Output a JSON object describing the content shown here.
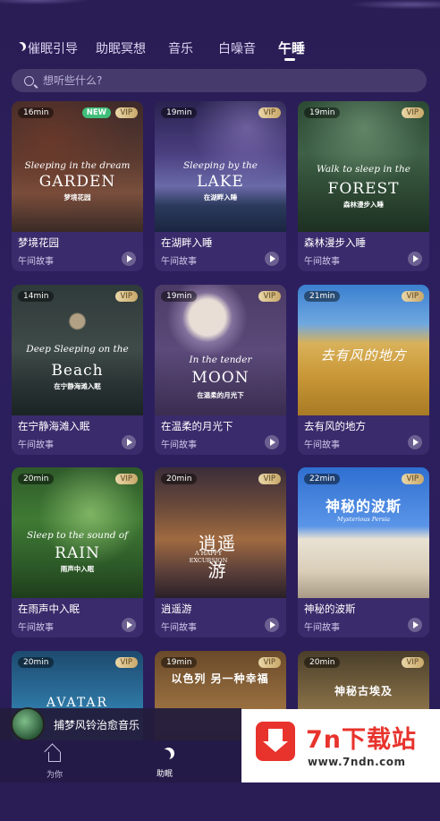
{
  "tabs": [
    {
      "label": "催眠引导"
    },
    {
      "label": "助眠冥想"
    },
    {
      "label": "音乐"
    },
    {
      "label": "白噪音"
    },
    {
      "label": "午睡"
    }
  ],
  "search": {
    "placeholder": "想听些什么?"
  },
  "cards": [
    {
      "duration": "16min",
      "badge_new": "NEW",
      "badge_vip": "VIP",
      "art_script": "Sleeping in the dream",
      "art_big": "GARDEN",
      "art_cn": "梦境花园",
      "title": "梦境花园",
      "subtitle": "午间故事"
    },
    {
      "duration": "19min",
      "badge_vip": "VIP",
      "art_script": "Sleeping by the",
      "art_big": "LAKE",
      "art_cn": "在湖畔入睡",
      "title": "在湖畔入睡",
      "subtitle": "午间故事"
    },
    {
      "duration": "19min",
      "badge_vip": "VIP",
      "art_script": "Walk to sleep in the",
      "art_big": "FOREST",
      "art_cn": "森林漫步入睡",
      "title": "森林漫步入睡",
      "subtitle": "午间故事"
    },
    {
      "duration": "14min",
      "badge_vip": "VIP",
      "art_script": "Deep Sleeping on the",
      "art_big": "Beach",
      "art_cn": "在宁静海滩入眠",
      "title": "在宁静海滩入眠",
      "subtitle": "午间故事"
    },
    {
      "duration": "19min",
      "badge_vip": "VIP",
      "art_script": "In the tender",
      "art_big": "MOON",
      "art_cn": "在温柔的月光下",
      "title": "在温柔的月光下",
      "subtitle": "午间故事"
    },
    {
      "duration": "21min",
      "badge_vip": "VIP",
      "art_script": "",
      "art_big": "去有风的地方",
      "art_cn": "",
      "title": "去有风的地方",
      "subtitle": "午间故事"
    },
    {
      "duration": "20min",
      "badge_vip": "VIP",
      "art_script": "Sleep to the sound of",
      "art_big": "RAIN",
      "art_cn": "雨声中入眠",
      "title": "在雨声中入眠",
      "subtitle": "午间故事"
    },
    {
      "duration": "20min",
      "badge_vip": "VIP",
      "art_script": "A HAPPY EXCURSION",
      "art_big": "逍遥游",
      "art_cn": "",
      "title": "逍遥游",
      "subtitle": "午间故事"
    },
    {
      "duration": "22min",
      "badge_vip": "VIP",
      "art_script": "Mysterious Persia",
      "art_big": "神秘的波斯",
      "art_cn": "",
      "title": "神秘的波斯",
      "subtitle": "午间故事"
    },
    {
      "duration": "20min",
      "badge_vip": "VIP",
      "art_big": "AVATAR"
    },
    {
      "duration": "19min",
      "badge_vip": "VIP",
      "art_big": "以色列 另一种幸福"
    },
    {
      "duration": "20min",
      "badge_vip": "VIP",
      "art_big": "神秘古埃及"
    }
  ],
  "mini_player": {
    "title": "捕梦风铃治愈音乐"
  },
  "nav": [
    {
      "label": "为你"
    },
    {
      "label": "助眠"
    }
  ],
  "watermark": {
    "title": "7n下载站",
    "url": "www.7ndn.com"
  }
}
